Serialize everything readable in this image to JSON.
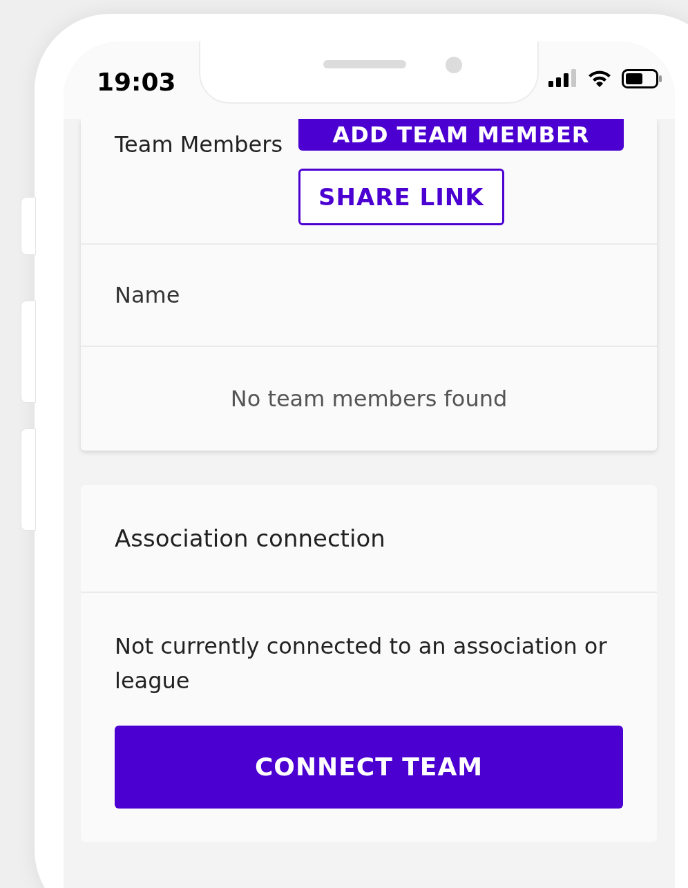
{
  "status_bar": {
    "time": "19:03"
  },
  "team_members": {
    "title": "Team Members",
    "buttons": [
      {
        "kind": "filled",
        "label": "ADD TEAM MEMBER"
      },
      {
        "kind": "outline",
        "label": "SHARE LINK"
      }
    ],
    "table": {
      "columns": [
        "Name"
      ],
      "empty_message": "No team members found"
    }
  },
  "association": {
    "title": "Association connection",
    "message": "Not currently connected to an association or league",
    "button": "CONNECT TEAM"
  }
}
